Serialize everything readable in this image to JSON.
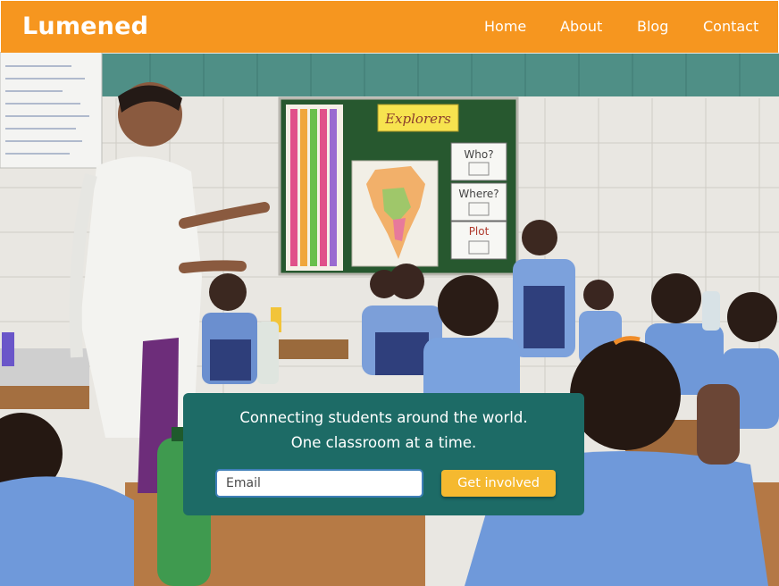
{
  "header": {
    "logo": "Lumened",
    "nav": [
      {
        "label": "Home"
      },
      {
        "label": "About"
      },
      {
        "label": "Blog"
      },
      {
        "label": "Contact"
      }
    ]
  },
  "hero": {
    "board_heading": "Explorers",
    "board_cards": [
      "Who?",
      "Where?",
      "Plot"
    ]
  },
  "signup": {
    "tagline_line1": "Connecting students around the world.",
    "tagline_line2": "One classroom at a time.",
    "email_placeholder": "Email",
    "button_label": "Get involved"
  },
  "colors": {
    "brand_orange": "#f6961f",
    "card_teal": "#1d6b66",
    "cta_yellow": "#f5b930"
  }
}
